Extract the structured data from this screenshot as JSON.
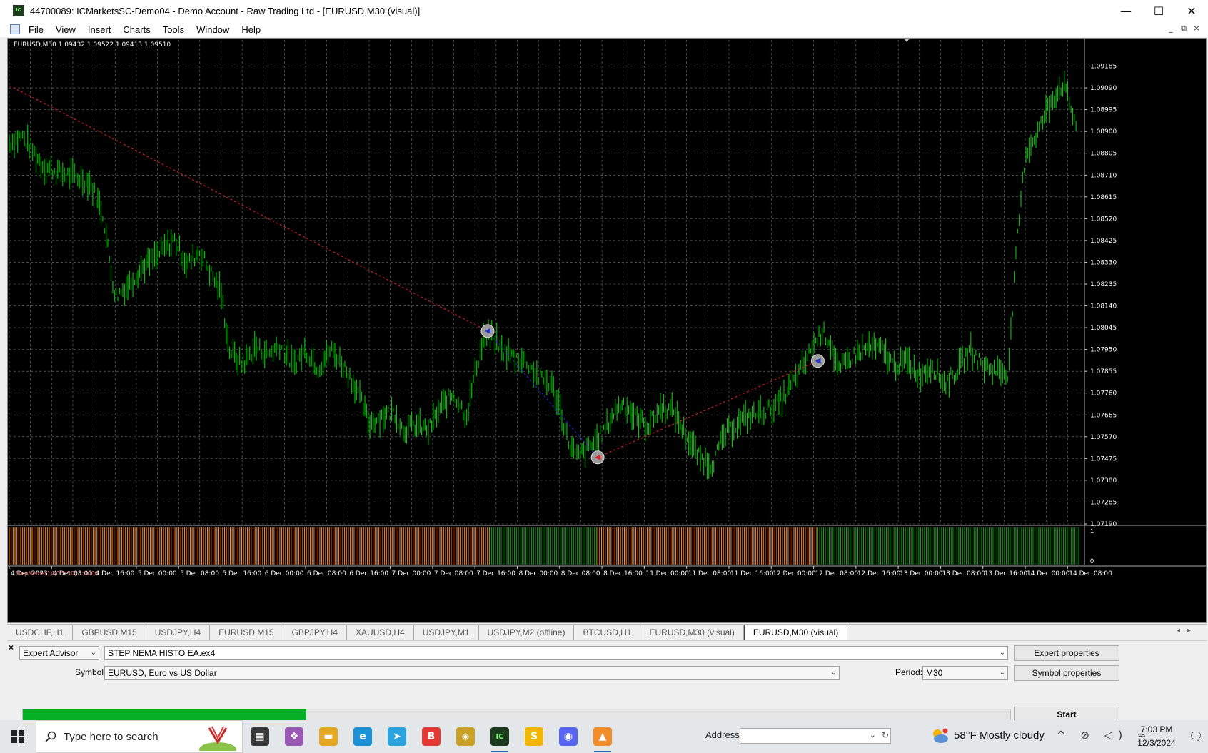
{
  "window": {
    "title": "44700089: ICMarketsSC-Demo04 - Demo Account - Raw Trading Ltd - [EURUSD,M30 (visual)]",
    "minimize": "—",
    "maximize": "☐",
    "close": "✕"
  },
  "menu": [
    "File",
    "View",
    "Insert",
    "Charts",
    "Tools",
    "Window",
    "Help"
  ],
  "chart": {
    "info": "EURUSD,M30  1.09432 1.09522 1.09413 1.09510",
    "indicator_label": "StepNema(14,0.5,50) 1.0000",
    "indicator_scale_top": "1",
    "indicator_scale_bottom": "0",
    "colors": {
      "background": "#000000",
      "grid": "#6e7a7a",
      "candles": "#00c800",
      "sell_line": "#c81e1e",
      "buy_line": "#1e28c8",
      "indicator_orange": "#ff8c1a",
      "indicator_green": "#1aa11a"
    }
  },
  "chart_data": {
    "type": "line",
    "title": "EURUSD,M30",
    "xlabel": "",
    "ylabel": "",
    "ylim": [
      1.0719,
      1.0928
    ],
    "y_ticks": [
      "1.09185",
      "1.09090",
      "1.08995",
      "1.08900",
      "1.08805",
      "1.08710",
      "1.08615",
      "1.08520",
      "1.08425",
      "1.08330",
      "1.08235",
      "1.08140",
      "1.08045",
      "1.07950",
      "1.07855",
      "1.07760",
      "1.07665",
      "1.07570",
      "1.07475",
      "1.07380",
      "1.07285",
      "1.07190"
    ],
    "x_ticks": [
      "4 Dec 2023",
      "4 Dec 08:00",
      "4 Dec 16:00",
      "5 Dec 00:00",
      "5 Dec 08:00",
      "5 Dec 16:00",
      "6 Dec 00:00",
      "6 Dec 08:00",
      "6 Dec 16:00",
      "7 Dec 00:00",
      "7 Dec 08:00",
      "7 Dec 16:00",
      "8 Dec 00:00",
      "8 Dec 08:00",
      "8 Dec 16:00",
      "11 Dec 00:00",
      "11 Dec 08:00",
      "11 Dec 16:00",
      "12 Dec 00:00",
      "12 Dec 08:00",
      "12 Dec 16:00",
      "13 Dec 00:00",
      "13 Dec 08:00",
      "13 Dec 16:00",
      "14 Dec 00:00",
      "14 Dec 08:00"
    ],
    "series": [
      {
        "x": [
          0,
          0.3,
          0.8,
          1.2,
          1.6,
          1.9,
          2.2,
          2.5,
          2.8,
          3.1,
          3.5,
          3.9,
          4.2,
          4.5,
          4.8,
          5.0,
          5.2,
          5.5,
          5.8,
          6.1,
          6.4,
          6.7,
          7.0,
          7.3,
          7.6,
          7.9,
          8.2,
          8.5,
          8.8,
          9.1,
          9.3,
          9.6,
          9.9,
          10.2,
          10.5,
          10.8,
          11.0,
          11.2,
          11.4,
          11.6,
          11.9,
          12.2,
          12.5,
          12.8,
          13.0,
          13.2,
          13.4,
          13.7,
          14.0,
          14.3,
          14.5,
          14.8,
          15.1,
          15.4,
          15.7,
          16.0,
          16.3,
          16.6,
          16.9,
          17.2,
          17.5,
          17.8,
          18.1,
          18.4,
          18.7,
          19.0,
          19.2,
          19.4,
          19.6,
          19.8,
          20.0,
          20.3,
          20.6,
          20.9,
          21.2,
          21.5,
          21.8,
          22.1,
          22.4,
          22.7,
          23.0,
          23.3,
          23.6,
          23.8,
          24.0,
          24.3,
          24.6,
          24.9,
          25.2
        ],
        "values": [
          1.0885,
          1.0888,
          1.0875,
          1.0872,
          1.087,
          1.0868,
          1.0855,
          1.0818,
          1.0823,
          1.083,
          1.0836,
          1.0843,
          1.0832,
          1.0838,
          1.0827,
          1.082,
          1.0795,
          1.0788,
          1.0796,
          1.0793,
          1.0797,
          1.0788,
          1.0795,
          1.0787,
          1.0795,
          1.0788,
          1.0778,
          1.0763,
          1.0766,
          1.0768,
          1.076,
          1.0762,
          1.076,
          1.077,
          1.0776,
          1.0766,
          1.0785,
          1.08,
          1.0802,
          1.0795,
          1.0792,
          1.079,
          1.0783,
          1.078,
          1.077,
          1.0755,
          1.0748,
          1.0752,
          1.0758,
          1.0768,
          1.0772,
          1.0765,
          1.0762,
          1.077,
          1.0768,
          1.0757,
          1.0748,
          1.0745,
          1.0758,
          1.0763,
          1.0766,
          1.0768,
          1.077,
          1.0777,
          1.0786,
          1.0797,
          1.0803,
          1.0798,
          1.0785,
          1.079,
          1.0793,
          1.0796,
          1.0795,
          1.0788,
          1.079,
          1.0784,
          1.0788,
          1.078,
          1.0786,
          1.0795,
          1.0788,
          1.0786,
          1.0785,
          1.084,
          1.088,
          1.089,
          1.0903,
          1.0911,
          1.0893
        ]
      }
    ],
    "trades": [
      {
        "open_x": 0,
        "open_y": 1.091,
        "close_x": 11.3,
        "close_y": 1.0803,
        "type": "sell"
      },
      {
        "open_x": 11.3,
        "open_y": 1.0803,
        "close_x": 13.9,
        "close_y": 1.0748,
        "type": "buy"
      },
      {
        "open_x": 13.9,
        "open_y": 1.0748,
        "close_x": 19.1,
        "close_y": 1.079,
        "type": "sell"
      }
    ],
    "indicator_segments": [
      {
        "from": 0,
        "to": 11.35,
        "color": "orange"
      },
      {
        "from": 11.35,
        "to": 13.9,
        "color": "green"
      },
      {
        "from": 13.9,
        "to": 19.1,
        "color": "orange"
      },
      {
        "from": 19.1,
        "to": 25.3,
        "color": "green"
      }
    ],
    "grid": true
  },
  "tabs": [
    "USDCHF,H1",
    "GBPUSD,M15",
    "USDJPY,H4",
    "EURUSD,M15",
    "GBPJPY,H4",
    "XAUUSD,H4",
    "USDJPY,M1",
    "USDJPY,M2 (offline)",
    "BTCUSD,H1",
    "EURUSD,M30 (visual)",
    "EURUSD,M30 (visual)"
  ],
  "active_tab_index": 10,
  "tab_scroll": "◂▸",
  "tester": {
    "close": "×",
    "type_value": "Expert Advisor",
    "expert_value": "STEP NEMA HISTO EA.ex4",
    "symbol_label": "Symbol:",
    "symbol_value": "EURUSD, Euro vs US Dollar",
    "period_label": "Period:",
    "period_value": "M30",
    "expert_properties": "Expert properties",
    "symbol_properties": "Symbol properties",
    "start": "Start",
    "progress": 0.287
  },
  "taskbar": {
    "search_placeholder": "Type here to search",
    "address_label": "Address",
    "weather": "58°F  Mostly cloudy",
    "time": "7:03 PM",
    "date": "12/3/2024",
    "tray": "^ ⊘ ◁) ≈",
    "notifications": "🗨",
    "apps": [
      {
        "name": "task-view-icon",
        "glyph": "▦",
        "color": "#3a3a3a"
      },
      {
        "name": "copilot-icon",
        "glyph": "❖",
        "color": "#9b59b6"
      },
      {
        "name": "file-explorer-icon",
        "glyph": "▬",
        "color": "#e5a823"
      },
      {
        "name": "edge-icon",
        "glyph": "e",
        "color": "#1f8fd6"
      },
      {
        "name": "telegram-icon",
        "glyph": "➤",
        "color": "#2aa3df"
      },
      {
        "name": "b-app-icon",
        "glyph": "B",
        "color": "#e53935"
      },
      {
        "name": "bitcoin-app-icon",
        "glyph": "◈",
        "color": "#c9a227"
      },
      {
        "name": "icmarkets-icon",
        "glyph": "IC",
        "color": "#1c3b1c"
      },
      {
        "name": "sticky-app-icon",
        "glyph": "S",
        "color": "#f2b705"
      },
      {
        "name": "discord-icon",
        "glyph": "◉",
        "color": "#5865f2"
      },
      {
        "name": "photos-icon",
        "glyph": "▲",
        "color": "#f28c28"
      }
    ]
  }
}
